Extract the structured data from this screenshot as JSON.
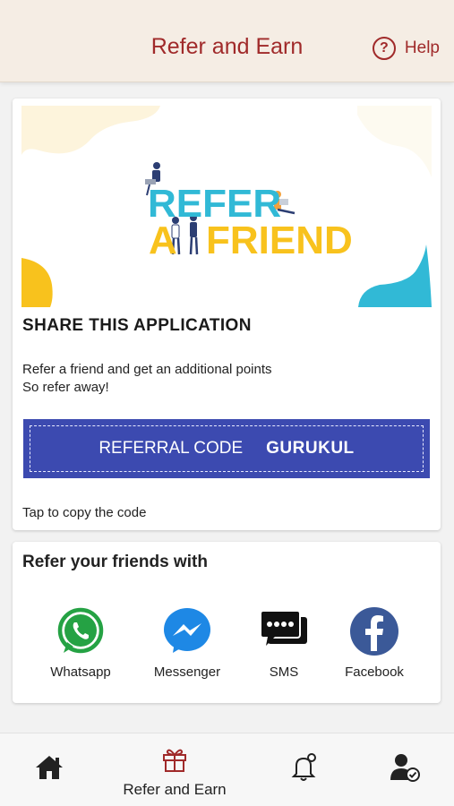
{
  "header": {
    "title": "Refer and Earn",
    "help_label": "Help",
    "help_icon": "question-circle-icon",
    "accent_color": "#a02a2a"
  },
  "banner": {
    "line1": "REFER",
    "line2_prefix": "A",
    "line2_rest": "FRIEND"
  },
  "share": {
    "title": "SHARE THIS APPLICATION",
    "desc_line1": "Refer a friend and get an additional points",
    "desc_line2": "So refer away!",
    "code_label": "REFERRAL CODE",
    "code_value": "GURUKUL",
    "tap_hint": "Tap to copy the code",
    "code_bg": "#3c4ab0"
  },
  "refer_with": {
    "title": "Refer your friends with",
    "options": [
      {
        "label": "Whatsapp",
        "icon": "whatsapp-icon",
        "color": "#25a244"
      },
      {
        "label": "Messenger",
        "icon": "messenger-icon",
        "color": "#1e88e5"
      },
      {
        "label": "SMS",
        "icon": "sms-icon",
        "color": "#111111"
      },
      {
        "label": "Facebook",
        "icon": "facebook-icon",
        "color": "#3b5998"
      }
    ]
  },
  "bottom_nav": {
    "items": [
      {
        "icon": "home-icon",
        "label": ""
      },
      {
        "icon": "gift-icon",
        "label": "Refer and Earn",
        "active": true
      },
      {
        "icon": "bell-icon",
        "label": ""
      },
      {
        "icon": "user-check-icon",
        "label": ""
      }
    ]
  }
}
